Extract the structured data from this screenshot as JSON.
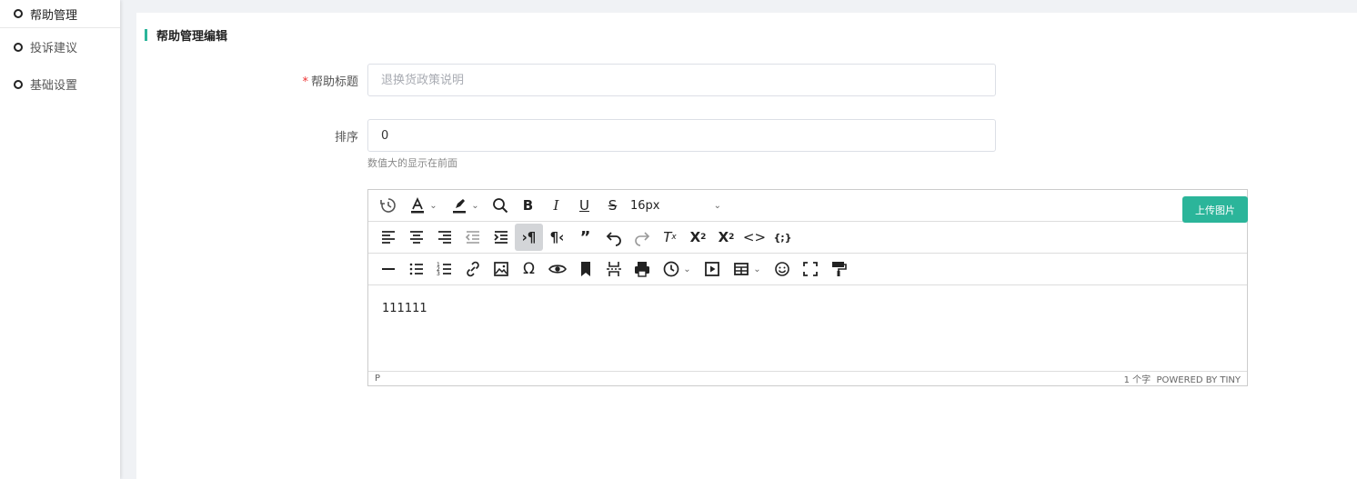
{
  "sidebar": {
    "items": [
      {
        "label": "帮助管理",
        "active": true
      },
      {
        "label": "投诉建议",
        "active": false
      },
      {
        "label": "基础设置",
        "active": false
      }
    ]
  },
  "section": {
    "title": "帮助管理编辑"
  },
  "form": {
    "title_label": "帮助标题",
    "title_required": "*",
    "title_value": "",
    "title_placeholder": "退换货政策说明",
    "sort_label": "排序",
    "sort_value": "0",
    "sort_hint": "数值大的显示在前面"
  },
  "editor": {
    "font_size": "16px",
    "upload_label": "上传图片",
    "content": "111111",
    "status_path": "P",
    "word_count": "1 个字",
    "powered": "POWERED BY TINY"
  },
  "colors": {
    "accent": "#2bb59a",
    "required": "#ee3333"
  }
}
